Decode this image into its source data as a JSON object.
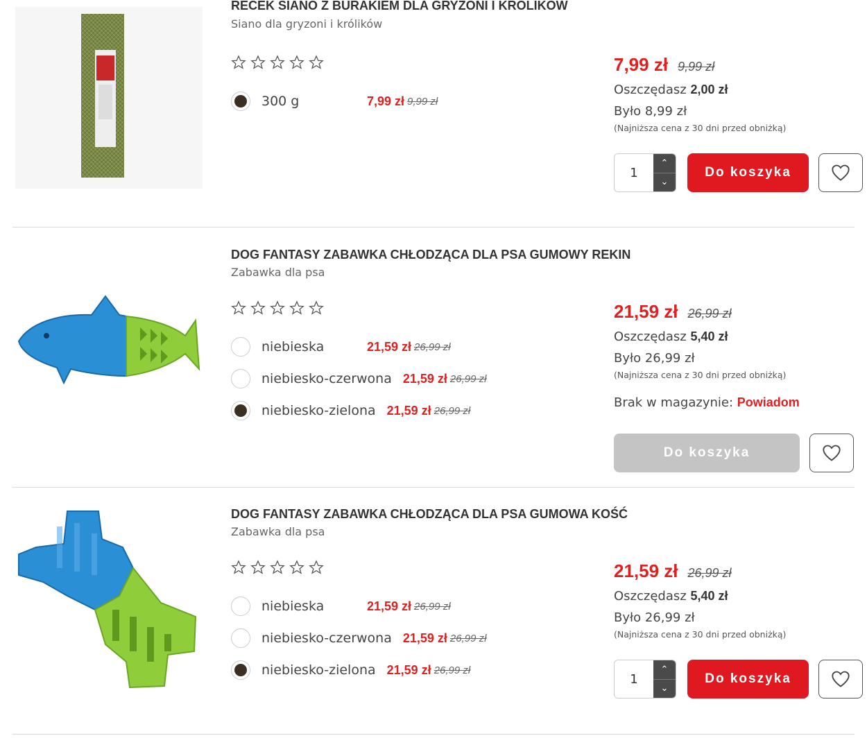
{
  "products": [
    {
      "title": "RECEK SIANO Z BURAKIEM DLA GRYZONI I KRÓLIKÓW",
      "subtitle": "Siano dla gryzoni i królików",
      "variants": [
        {
          "name": "300 g",
          "price": "7,99 zł",
          "old_price": "9,99 zł",
          "selected": true
        }
      ],
      "price": "7,99 zł",
      "old_price": "9,99 zł",
      "save_label": "Oszczędasz",
      "save_value": "2,00 zł",
      "was": "Było 8,99 zł",
      "lowest_note": "(Najniższa cena z 30 dni przed obniżką)",
      "quantity": "1",
      "cart_label": "Do koszyka",
      "in_stock": true
    },
    {
      "title": "DOG FANTASY ZABAWKA CHŁODZĄCA DLA PSA GUMOWY REKIN",
      "subtitle": "Zabawka dla psa",
      "variants": [
        {
          "name": "niebieska",
          "price": "21,59 zł",
          "old_price": "26,99 zł",
          "selected": false
        },
        {
          "name": "niebiesko-czerwona",
          "price": "21,59 zł",
          "old_price": "26,99 zł",
          "selected": false
        },
        {
          "name": "niebiesko-zielona",
          "price": "21,59 zł",
          "old_price": "26,99 zł",
          "selected": true
        }
      ],
      "price": "21,59 zł",
      "old_price": "26,99 zł",
      "save_label": "Oszczędasz",
      "save_value": "5,40 zł",
      "was": "Było 26,99 zł",
      "lowest_note": "(Najniższa cena z 30 dni przed obniżką)",
      "stock_label": "Brak w magazynie:",
      "notify_label": "Powiadom",
      "cart_label": "Do koszyka",
      "in_stock": false
    },
    {
      "title": "DOG FANTASY ZABAWKA CHŁODZĄCA DLA PSA GUMOWA KOŚĆ",
      "subtitle": "Zabawka dla psa",
      "variants": [
        {
          "name": "niebieska",
          "price": "21,59 zł",
          "old_price": "26,99 zł",
          "selected": false
        },
        {
          "name": "niebiesko-czerwona",
          "price": "21,59 zł",
          "old_price": "26,99 zł",
          "selected": false
        },
        {
          "name": "niebiesko-zielona",
          "price": "21,59 zł",
          "old_price": "26,99 zł",
          "selected": true
        }
      ],
      "price": "21,59 zł",
      "old_price": "26,99 zł",
      "save_label": "Oszczędasz",
      "save_value": "5,40 zł",
      "was": "Było 26,99 zł",
      "lowest_note": "(Najniższa cena z 30 dni przed obniżką)",
      "quantity": "1",
      "cart_label": "Do koszyka",
      "in_stock": true
    }
  ],
  "colors": {
    "accent": "#e0181f",
    "price_red": "#e02020",
    "disabled": "#c4c4c4",
    "radio_dot": "#3b2f24"
  },
  "icons": {
    "star": "star-outline-icon",
    "heart": "heart-outline-icon",
    "up": "chevron-up-icon",
    "down": "chevron-down-icon"
  }
}
